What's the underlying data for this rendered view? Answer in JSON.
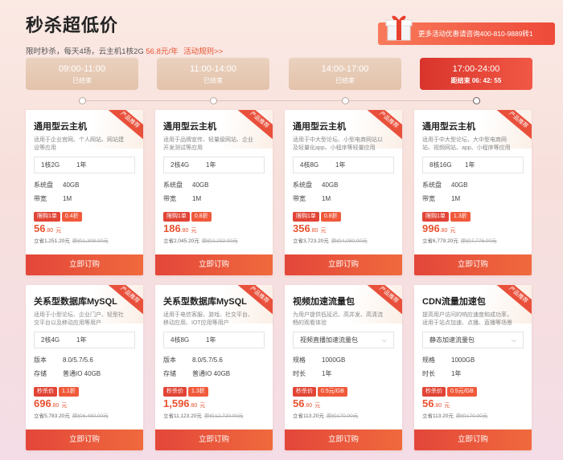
{
  "header": {
    "title": "秒杀超低价",
    "subtitle_prefix": "限时秒杀，每天4场，云主机1核2G ",
    "subtitle_price": "56.8元/年",
    "rules_link": "活动规则>>"
  },
  "promo": {
    "text": "更多活动优惠请咨询400-810-9889转1"
  },
  "timeline": [
    {
      "time": "09:00-11:00",
      "status": "已结束"
    },
    {
      "time": "11:00-14:00",
      "status": "已结束"
    },
    {
      "time": "14:00-17:00",
      "status": "已结束"
    },
    {
      "time": "17:00-24:00",
      "status": "距结束 06: 42: 55"
    }
  ],
  "ribbon_text": "产品推荐",
  "buy_label": "立即订购",
  "cards": [
    {
      "title": "通用型云主机",
      "desc": "适用于企业官网、个人网站、网站建设等应用",
      "spec": "1核2G",
      "years": "1年",
      "k1": "系统盘",
      "v1": "40GB",
      "k2": "带宽",
      "v2": "1M",
      "tag1": "限购1单",
      "tag2": "0.4折",
      "price_int": "56",
      "price_dec": ".80",
      "unit": "元",
      "save": "立省1,251.20元",
      "orig": "原价1,308.00元"
    },
    {
      "title": "通用型云主机",
      "desc": "适用于品牌宣传、轻量级网站、企业开发测试等应用",
      "spec": "2核4G",
      "years": "1年",
      "k1": "系统盘",
      "v1": "40GB",
      "k2": "带宽",
      "v2": "1M",
      "tag1": "限购1单",
      "tag2": "0.8折",
      "price_int": "186",
      "price_dec": ".80",
      "unit": "元",
      "save": "立省2,045.20元",
      "orig": "原价2,232.00元"
    },
    {
      "title": "通用型云主机",
      "desc": "适用于中大型论坛、小型电商网站以及轻量化app、小程序等轻量应用",
      "spec": "4核8G",
      "years": "1年",
      "k1": "系统盘",
      "v1": "40GB",
      "k2": "带宽",
      "v2": "1M",
      "tag1": "限购1单",
      "tag2": "0.8折",
      "price_int": "356",
      "price_dec": ".80",
      "unit": "元",
      "save": "立省3,723.20元",
      "orig": "原价4,080.00元"
    },
    {
      "title": "通用型云主机",
      "desc": "适用于中大型论坛、大中型电商网站、视频网站、app、小程序等应用",
      "spec": "8核16G",
      "years": "1年",
      "k1": "系统盘",
      "v1": "40GB",
      "k2": "带宽",
      "v2": "1M",
      "tag1": "限购1单",
      "tag2": "1.3折",
      "price_int": "996",
      "price_dec": ".80",
      "unit": "元",
      "save": "立省6,779.20元",
      "orig": "原价7,776.00元"
    },
    {
      "title": "关系型数据库MySQL",
      "desc": "适用于小型论坛、企业门户、轻型社交平台以及移动应用等用户",
      "spec": "2核4G",
      "years": "1年",
      "k1": "版本",
      "v1": "8.0/5.7/5.6",
      "k2": "存储",
      "v2": "普通IO 40GB",
      "tag1": "秒杀价",
      "tag2": "1.1折",
      "price_int": "696",
      "price_dec": ".80",
      "unit": "元",
      "save": "立省5,783.20元",
      "orig": "原价6,480.00元"
    },
    {
      "title": "关系型数据库MySQL",
      "desc": "适用于电信客服、游戏、社交平台、移动应用、IOT应用等用户",
      "spec": "4核8G",
      "years": "1年",
      "k1": "版本",
      "v1": "8.0/5.7/5.6",
      "k2": "存储",
      "v2": "普通IO 40GB",
      "tag1": "秒杀价",
      "tag2": "1.3折",
      "price_int": "1,596",
      "price_dec": ".80",
      "unit": "元",
      "save": "立省11,123.20元",
      "orig": "原价12,720.00元"
    },
    {
      "title": "视频加速流量包",
      "desc": "为用户提供低延迟、高并发、高清流畅的观看体验",
      "spec": "视频直播加速流量包",
      "years": "",
      "k1": "规格",
      "v1": "1000GB",
      "k2": "时长",
      "v2": "1年",
      "tag1": "秒杀价",
      "tag2": "0.5元/GB",
      "price_int": "56",
      "price_dec": ".80",
      "unit": "元",
      "save": "立省113.20元",
      "orig": "原价170.00元"
    },
    {
      "title": "CDN流量加速包",
      "desc": "提高用户访问的响应速度和成功率，适用于站点加速、点播、直播等场景",
      "spec": "静态加速流量包",
      "years": "",
      "k1": "规格",
      "v1": "1000GB",
      "k2": "时长",
      "v2": "1年",
      "tag1": "秒杀价",
      "tag2": "0.5元/GB",
      "price_int": "56",
      "price_dec": ".80",
      "unit": "元",
      "save": "立省113.20元",
      "orig": "原价170.00元"
    }
  ]
}
